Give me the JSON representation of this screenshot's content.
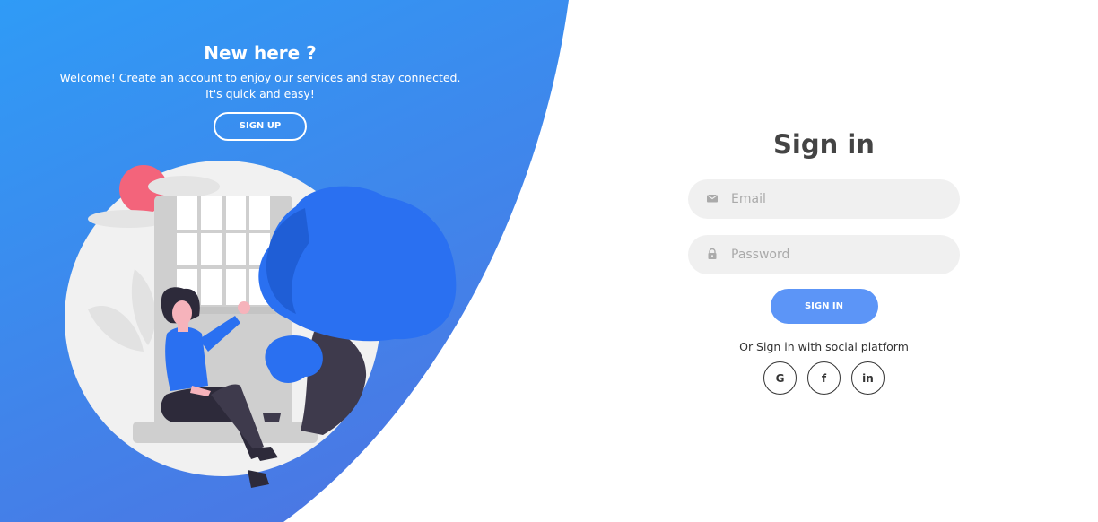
{
  "left_panel": {
    "title": "New here ?",
    "description_line1": "Welcome! Create an account to enjoy our services and stay connected.",
    "description_line2": "It's quick and easy!",
    "signup_label": "SIGN UP"
  },
  "signin_form": {
    "title": "Sign in",
    "email_placeholder": "Email",
    "password_placeholder": "Password",
    "submit_label": "SIGN IN",
    "social_text": "Or Sign in with social platform",
    "social": [
      {
        "label": "G",
        "icon": "google-icon"
      },
      {
        "label": "f",
        "icon": "facebook-icon"
      },
      {
        "label": "in",
        "icon": "linkedin-icon"
      }
    ]
  },
  "colors": {
    "accent_top": "#2f98f5",
    "accent_bottom": "#4a7ee6",
    "button_blue": "#5c95f7",
    "input_bg": "#f0f0f0",
    "title_text": "#444444"
  }
}
